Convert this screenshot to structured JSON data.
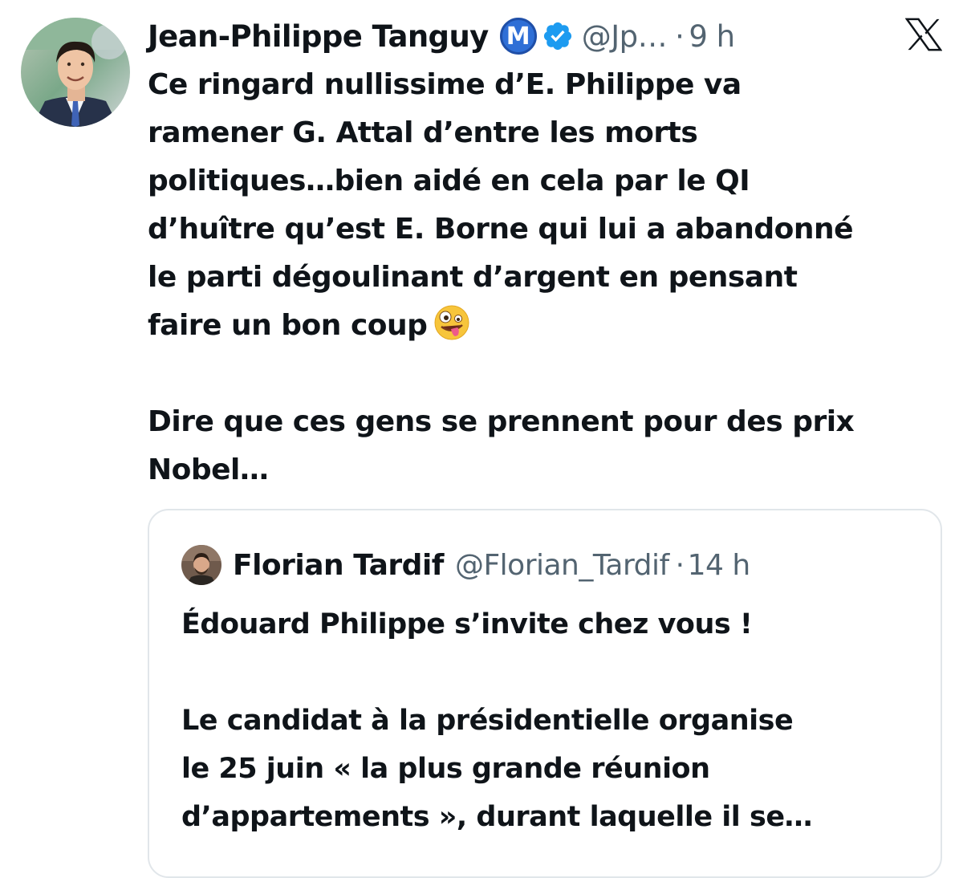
{
  "tweet": {
    "author": {
      "name": "Jean-Philippe Tanguy",
      "badge_letter": "M",
      "handle": "@Jp…",
      "separator": "·",
      "time": "9 h",
      "avatar_icon": "profile-photo-man-in-suit"
    },
    "text_lines": [
      "Ce ringard nullissime d’E. Philippe va",
      "ramener G. Attal d’entre les morts",
      "politiques…bien aidé en cela par le QI",
      "d’huître qu’est E. Borne qui lui a abandonné",
      "le parti dégoulinant d’argent en pensant",
      "faire un bon coup"
    ],
    "emoji": "zany-face-emoji",
    "text2_lines": [
      "Dire que ces gens se prennent pour des prix",
      "Nobel…"
    ],
    "platform_icon": "x-logo-icon"
  },
  "quote": {
    "author": {
      "name": "Florian Tardif",
      "handle": "@Florian_Tardif",
      "separator": "·",
      "time": "14 h",
      "avatar_icon": "profile-photo-man-with-beard"
    },
    "text_line1": "Édouard Philippe s’invite chez vous !",
    "text2_lines": [
      "Le candidat à la présidentielle organise",
      "le 25 juin « la plus grande réunion",
      "d’appartements », durant laquelle il se…"
    ]
  },
  "colors": {
    "text": "#0f1419",
    "secondary": "#536471",
    "verified_blue": "#1d9bf0",
    "badge_blue": "#2f6fd6",
    "border": "#e1e6ea"
  }
}
